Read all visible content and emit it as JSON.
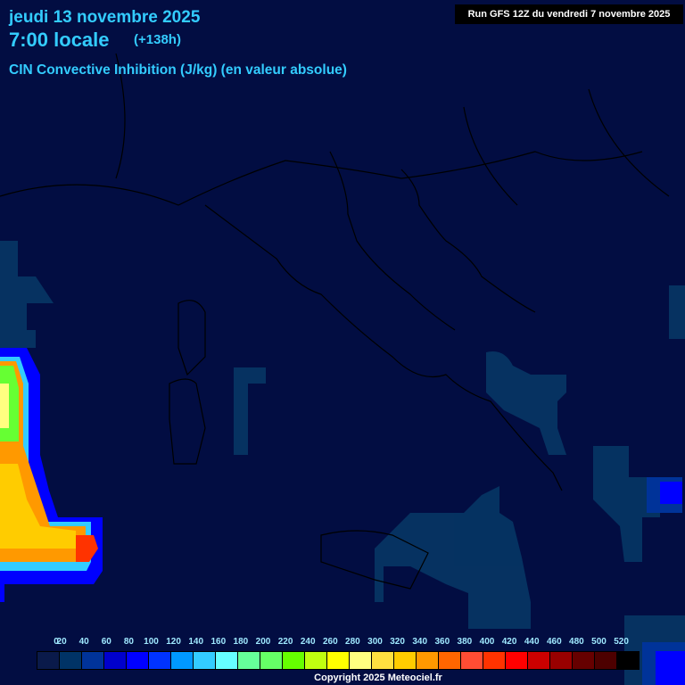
{
  "header": {
    "date": "jeudi 13 novembre 2025",
    "local_time": "7:00 locale",
    "lead_time": "(+138h)",
    "parameter": "CIN Convective Inhibition (J/kg) (en valeur absolue)",
    "run_info": "Run GFS 12Z du vendredi 7 novembre 2025"
  },
  "legend": {
    "labels": [
      "0",
      "20",
      "40",
      "60",
      "80",
      "100",
      "120",
      "140",
      "160",
      "180",
      "200",
      "220",
      "240",
      "260",
      "280",
      "300",
      "320",
      "340",
      "360",
      "380",
      "400",
      "420",
      "440",
      "460",
      "480",
      "500",
      "520"
    ],
    "colors": [
      "#0a1a4a",
      "#003366",
      "#003399",
      "#0000cc",
      "#0000ff",
      "#0033ff",
      "#0099ff",
      "#33ccff",
      "#66ffff",
      "#66ff99",
      "#66ff66",
      "#66ff00",
      "#c0ff10",
      "#ffff00",
      "#ffff80",
      "#ffe040",
      "#ffcc00",
      "#ff9900",
      "#ff6600",
      "#ff4d33",
      "#ff3300",
      "#ff0000",
      "#cc0000",
      "#990000",
      "#660000",
      "#4d0000",
      "#000000"
    ]
  },
  "footer": {
    "copyright": "Copyright 2025 Meteociel.fr"
  }
}
